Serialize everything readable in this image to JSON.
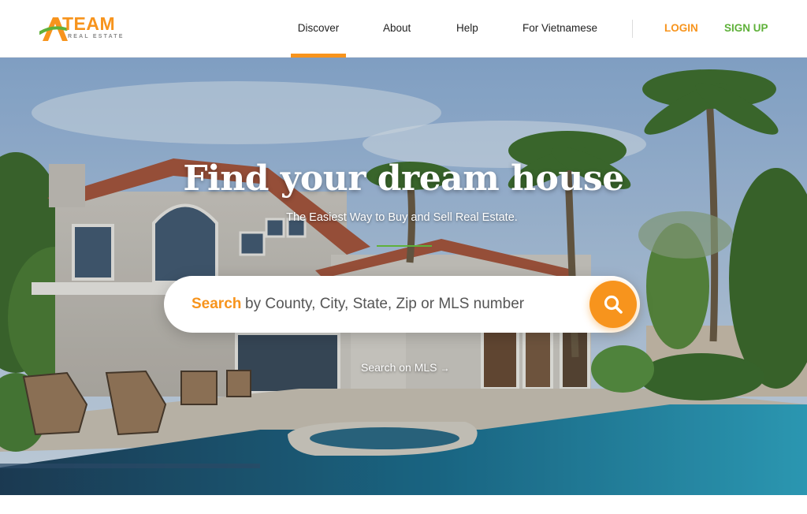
{
  "brand": {
    "logo_letter": "A",
    "logo_word": "TEAM",
    "logo_tagline": "REAL ESTATE"
  },
  "nav": {
    "items": [
      {
        "label": "Discover",
        "active": true
      },
      {
        "label": "About",
        "active": false
      },
      {
        "label": "Help",
        "active": false
      },
      {
        "label": "For Vietnamese",
        "active": false
      }
    ],
    "login_label": "LOGIN",
    "signup_label": "SIGN UP"
  },
  "hero": {
    "title": "Find your dream house",
    "subtitle": "The Easiest Way to Buy and Sell Real Estate.",
    "background_image": "house-with-pool-photo"
  },
  "search": {
    "label": "Search",
    "placeholder": "by County, City, State, Zip or MLS number",
    "button_icon": "search-icon"
  },
  "mls_link": {
    "label": "Search on MLS",
    "icon": "arrow-right-icon"
  },
  "colors": {
    "accent": "#f7941d",
    "green": "#5fb13a"
  }
}
